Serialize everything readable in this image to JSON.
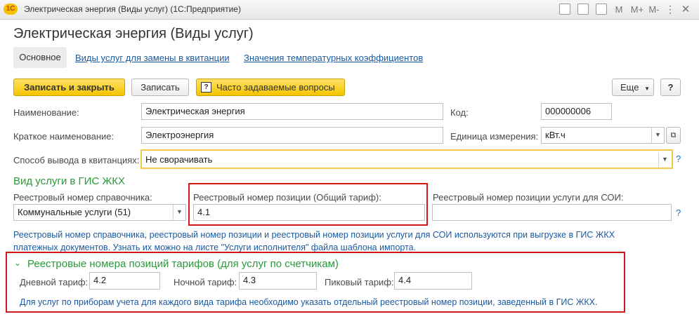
{
  "window": {
    "app_badge": "1С",
    "title": "Электрическая энергия (Виды услуг)  (1С:Предприятие)",
    "toolbar": {
      "m": "M",
      "m_plus": "M+",
      "m_minus": "M-",
      "close": "✕"
    }
  },
  "page_title": "Электрическая энергия (Виды услуг)",
  "tabs": [
    {
      "label": "Основное",
      "active": true
    },
    {
      "label": "Виды услуг для замены в квитанции"
    },
    {
      "label": "Значения температурных коэффициентов"
    }
  ],
  "commands": {
    "save_close": "Записать и закрыть",
    "save": "Записать",
    "faq_icon": "?",
    "faq": "Часто задаваемые вопросы",
    "more": "Еще",
    "help": "?"
  },
  "fields": {
    "name_label": "Наименование:",
    "name_value": "Электрическая энергия",
    "code_label": "Код:",
    "code_value": "000000006",
    "short_label": "Краткое наименование:",
    "short_value": "Электроэнергия",
    "unit_label": "Единица измерения:",
    "unit_value": "кВт.ч",
    "output_label": "Способ вывода в квитанциях:",
    "output_value": "Не сворачивать",
    "output_help": "?"
  },
  "gis": {
    "section_title": "Вид услуги в ГИС ЖКХ",
    "registry_label": "Реестровый номер справочника:",
    "registry_value": "Коммунальные услуги (51)",
    "position_label": "Реестровый номер позиции (Общий тариф):",
    "position_value": "4.1",
    "soi_label": "Реестровый номер позиции услуги для СОИ:",
    "soi_value": "",
    "soi_help": "?",
    "hint_line1": "Реестровый номер справочника, реестровый номер позиции и реестровый номер позиции услуги для СОИ используются при выгрузке в ГИС ЖКХ",
    "hint_line2": "платежных документов. Узнать их можно на листе \"Услуги исполнителя\" файла шаблона импорта."
  },
  "tariffs": {
    "section_title": "Реестровые номера позиций тарифов (для услуг по счетчикам)",
    "day_label": "Дневной тариф:",
    "day_value": "4.2",
    "night_label": "Ночной тариф:",
    "night_value": "4.3",
    "peak_label": "Пиковый тариф:",
    "peak_value": "4.4",
    "hint": "Для услуг по приборам учета для каждого вида тарифа необходимо указать отдельный реестровый номер позиции, заведенный в ГИС ЖКХ."
  },
  "colors": {
    "accent_green": "#2a9a3a",
    "link_blue": "#1a5aa0",
    "highlight_red": "#d21a1a",
    "button_yellow": "#f5c400"
  }
}
